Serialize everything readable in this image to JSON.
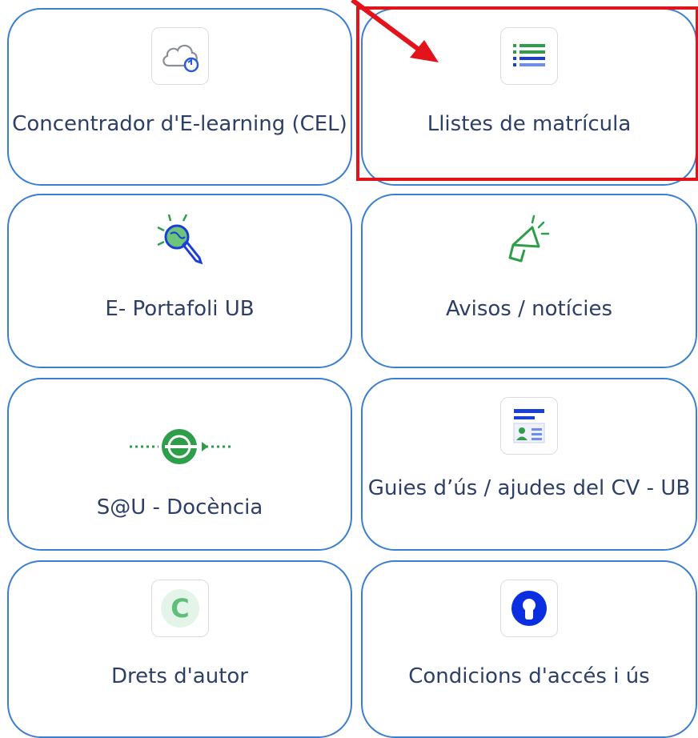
{
  "tiles": {
    "cel": {
      "label": "Concentrador d'E-learning (CEL)",
      "icon": "cloud-sync-icon"
    },
    "llistes": {
      "label": "Llistes de matrícula",
      "icon": "list-icon"
    },
    "portafoli": {
      "label": "E- Portafoli UB",
      "icon": "globe-pen-icon"
    },
    "avisos": {
      "label": "Avisos / notícies",
      "icon": "megaphone-icon"
    },
    "sau": {
      "label": "S@U - Docència",
      "icon": "route-icon"
    },
    "guies": {
      "label": "Guies d’ús / ajudes del CV - UB",
      "icon": "id-card-icon"
    },
    "drets": {
      "label": "Drets d'autor",
      "icon": "copyright-icon"
    },
    "condicions": {
      "label": "Condicions d'accés i ús",
      "icon": "keyhole-icon"
    }
  },
  "colors": {
    "tile_border": "#3b7fd0",
    "label_text": "#2d3f66",
    "highlight": "#e3131b",
    "green": "#2e9e4a",
    "blue": "#1a3fd6"
  }
}
